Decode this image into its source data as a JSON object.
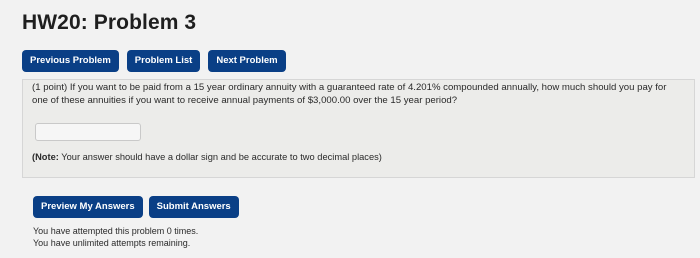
{
  "page": {
    "title": "HW20: Problem 3"
  },
  "nav": {
    "previous": "Previous Problem",
    "list": "Problem List",
    "next": "Next Problem"
  },
  "problem": {
    "text_line1": "(1 point) If you want to be paid from a 15 year ordinary annuity with a guaranteed rate of 4.201% compounded annually, how much should you pay for",
    "text_line2": "one of these annuities if you want to receive annual payments of $3,000.00 over the 15 year period?",
    "answer_value": "",
    "note_label": "(Note:",
    "note_text": " Your answer should have a dollar sign and be accurate to two decimal places)"
  },
  "actions": {
    "preview": "Preview My Answers",
    "submit": "Submit Answers"
  },
  "status": {
    "attempts_line1": "You have attempted this problem 0 times.",
    "attempts_line2": "You have unlimited attempts remaining."
  },
  "colors": {
    "button_bg": "#0a3f86",
    "panel_bg": "#ececea",
    "page_bg": "#f2f2f2"
  }
}
